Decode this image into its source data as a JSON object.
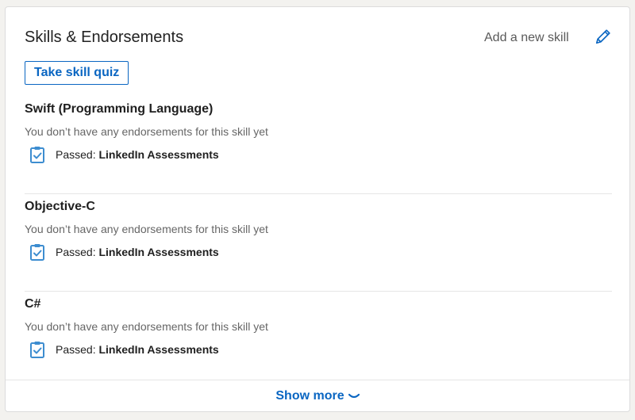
{
  "header": {
    "title": "Skills & Endorsements",
    "add_skill_label": "Add a new skill",
    "edit_icon": "pencil-icon"
  },
  "quiz_button": {
    "label": "Take skill quiz"
  },
  "skills": [
    {
      "name": "Swift (Programming Language)",
      "endorsement_text": "You don’t have any endorsements for this skill yet",
      "assessment_prefix": "Passed:",
      "assessment_name": "LinkedIn Assessments"
    },
    {
      "name": "Objective-C",
      "endorsement_text": "You don’t have any endorsements for this skill yet",
      "assessment_prefix": "Passed:",
      "assessment_name": "LinkedIn Assessments"
    },
    {
      "name": "C#",
      "endorsement_text": "You don’t have any endorsements for this skill yet",
      "assessment_prefix": "Passed:",
      "assessment_name": "LinkedIn Assessments"
    }
  ],
  "footer": {
    "show_more_label": "Show more"
  },
  "colors": {
    "accent": "#0a66c2",
    "icon": "#3d8dd0",
    "muted_text": "#666666"
  }
}
